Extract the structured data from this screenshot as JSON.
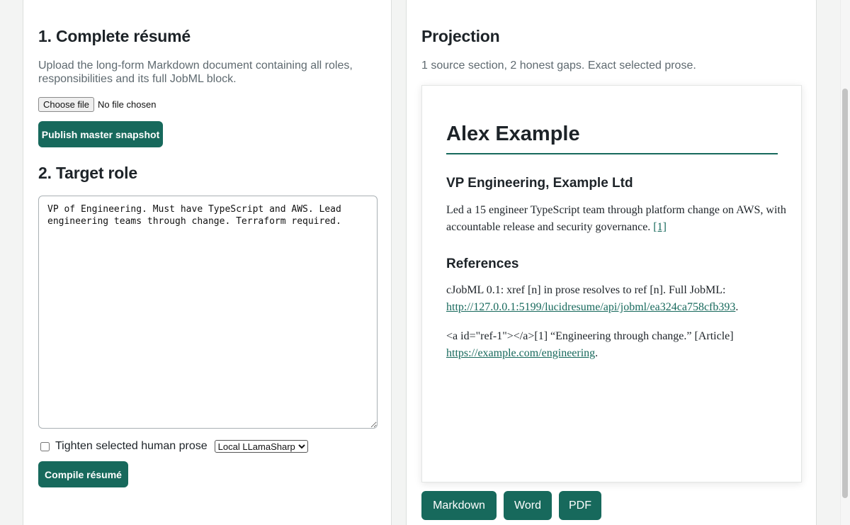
{
  "master": {
    "heading": "1. Complete résumé",
    "description_line1": "Upload the long-form Markdown document containing all roles,",
    "description_line2": "responsibilities and its full JobML block.",
    "choose_file_label": "Choose file",
    "file_status": "No file chosen",
    "publish_label": "Publish master snapshot"
  },
  "target": {
    "heading": "2. Target role",
    "role_text": "VP of Engineering. Must have TypeScript and AWS. Lead engineering teams through change. Terraform required.",
    "tighten_label": "Tighten selected human prose",
    "tighten_checked": false,
    "model_selected": "Local LLamaSharp",
    "compile_label": "Compile résumé"
  },
  "projection": {
    "heading": "Projection",
    "summary": "1 source section, 2 honest gaps. Exact selected prose.",
    "document": {
      "name": "Alex Example",
      "role_heading": "VP Engineering, Example Ltd",
      "role_text": "Led a 15 engineer TypeScript team through platform change on AWS, with accountable release and security governance.",
      "role_ref": "[1]",
      "references_heading": "References",
      "ref_intro": "cJobML 0.1: xref [n] in prose resolves to ref [n]. Full JobML:",
      "ref_intro_link": "http://127.0.0.1:5199/lucidresume/api/jobml/ea324ca758cfb393",
      "ref_intro_end": ".",
      "ref1_text": "<a id=\"ref-1\"></a>[1] “Engineering through change.” [Article]",
      "ref1_link": "https://example.com/engineering",
      "ref1_end": "."
    },
    "formats": {
      "markdown": "Markdown",
      "word": "Word",
      "pdf": "PDF"
    }
  },
  "colors": {
    "accent": "#17695c",
    "text": "#1d2328",
    "muted": "#5f6a70"
  }
}
